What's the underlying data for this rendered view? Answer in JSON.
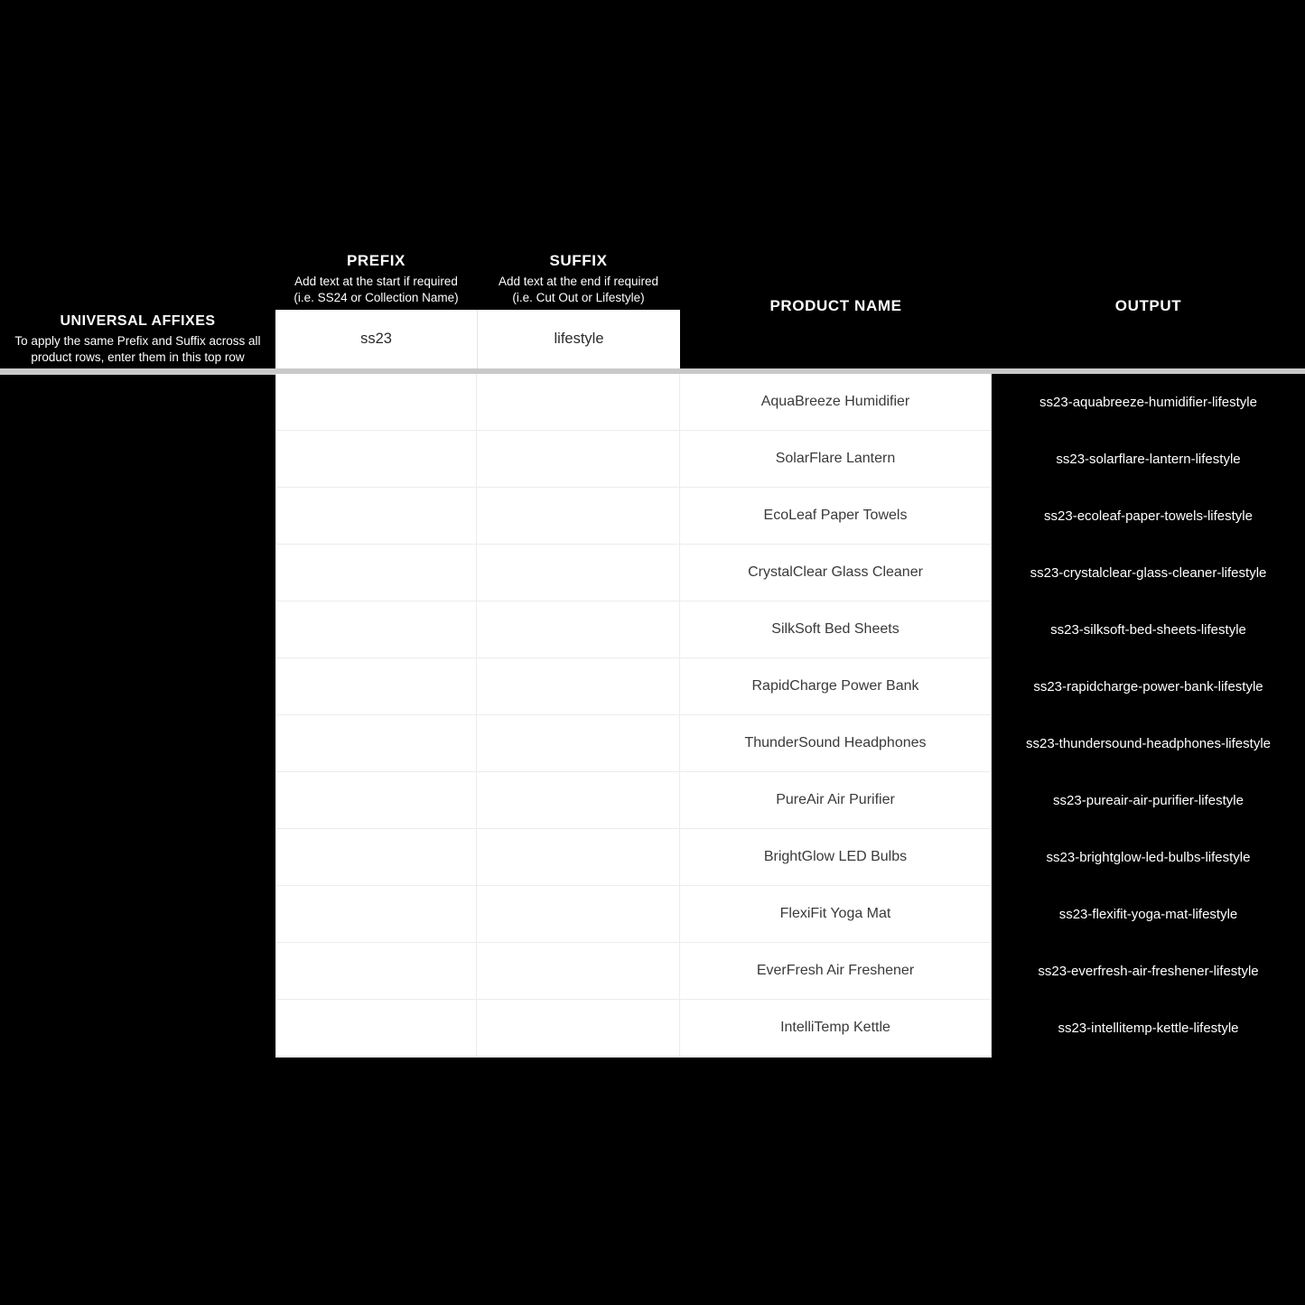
{
  "headers": {
    "prefix": {
      "title": "PREFIX",
      "sub_line1": "Add text at the start if required",
      "sub_line2": "(i.e. SS24 or Collection Name)"
    },
    "suffix": {
      "title": "SUFFIX",
      "sub_line1": "Add text at the end if required",
      "sub_line2": "(i.e. Cut Out or Lifestyle)"
    },
    "product_name": "PRODUCT NAME",
    "output": "OUTPUT"
  },
  "universal_affixes": {
    "title": "UNIVERSAL AFFIXES",
    "sub_line1": "To apply the same Prefix and Suffix across all",
    "sub_line2": "product rows, enter them in this top row",
    "prefix_value": "ss23",
    "suffix_value": "lifestyle"
  },
  "rows": [
    {
      "prefix": "",
      "suffix": "",
      "product_name": "AquaBreeze Humidifier",
      "output": "ss23-aquabreeze-humidifier-lifestyle"
    },
    {
      "prefix": "",
      "suffix": "",
      "product_name": "SolarFlare Lantern",
      "output": "ss23-solarflare-lantern-lifestyle"
    },
    {
      "prefix": "",
      "suffix": "",
      "product_name": "EcoLeaf Paper Towels",
      "output": "ss23-ecoleaf-paper-towels-lifestyle"
    },
    {
      "prefix": "",
      "suffix": "",
      "product_name": "CrystalClear Glass Cleaner",
      "output": "ss23-crystalclear-glass-cleaner-lifestyle"
    },
    {
      "prefix": "",
      "suffix": "",
      "product_name": "SilkSoft Bed Sheets",
      "output": "ss23-silksoft-bed-sheets-lifestyle"
    },
    {
      "prefix": "",
      "suffix": "",
      "product_name": "RapidCharge Power Bank",
      "output": "ss23-rapidcharge-power-bank-lifestyle"
    },
    {
      "prefix": "",
      "suffix": "",
      "product_name": "ThunderSound Headphones",
      "output": "ss23-thundersound-headphones-lifestyle"
    },
    {
      "prefix": "",
      "suffix": "",
      "product_name": "PureAir Air Purifier",
      "output": "ss23-pureair-air-purifier-lifestyle"
    },
    {
      "prefix": "",
      "suffix": "",
      "product_name": "BrightGlow LED Bulbs",
      "output": "ss23-brightglow-led-bulbs-lifestyle"
    },
    {
      "prefix": "",
      "suffix": "",
      "product_name": "FlexiFit Yoga Mat",
      "output": "ss23-flexifit-yoga-mat-lifestyle"
    },
    {
      "prefix": "",
      "suffix": "",
      "product_name": "EverFresh Air Freshener",
      "output": "ss23-everfresh-air-freshener-lifestyle"
    },
    {
      "prefix": "",
      "suffix": "",
      "product_name": "IntelliTemp Kettle",
      "output": "ss23-intellitemp-kettle-lifestyle"
    }
  ],
  "colors": {
    "background": "#000000",
    "surface": "#ffffff",
    "text_dark": "#3a3a3a",
    "text_light": "#ffffff",
    "separator": "#c9c9c9",
    "grid_line": "#ececec"
  }
}
